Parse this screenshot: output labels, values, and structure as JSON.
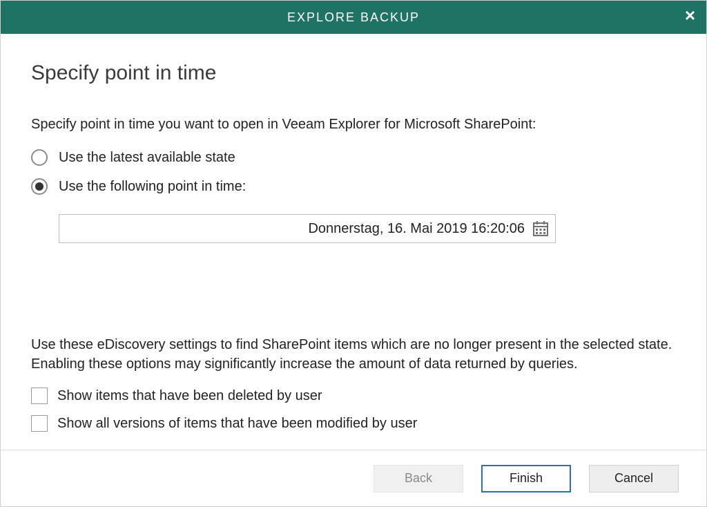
{
  "titlebar": {
    "title": "EXPLORE BACKUP"
  },
  "page": {
    "heading": "Specify point in time",
    "intro": "Specify point in time you want to open in Veeam Explorer for Microsoft SharePoint:"
  },
  "point_in_time": {
    "option_latest": {
      "label": "Use the latest available state",
      "selected": false
    },
    "option_specific": {
      "label": "Use the following point in time:",
      "selected": true,
      "value": "Donnerstag, 16. Mai 2019 16:20:06"
    }
  },
  "ediscovery": {
    "intro": "Use these eDiscovery settings to find SharePoint items which are no longer present in the selected state. Enabling these options may significantly increase the amount of data returned by queries.",
    "show_deleted": {
      "label": "Show items that have been deleted by user",
      "checked": false
    },
    "show_versions": {
      "label": "Show all versions of items that have been modified by user",
      "checked": false
    }
  },
  "footer": {
    "back": "Back",
    "finish": "Finish",
    "cancel": "Cancel"
  }
}
